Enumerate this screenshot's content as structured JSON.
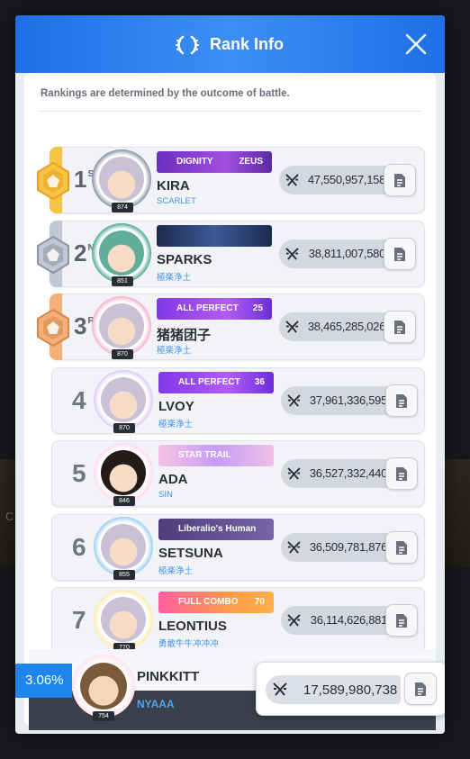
{
  "window": {
    "title": "Rank Info"
  },
  "description": "Rankings are determined by the outcome of battle.",
  "background_text": "C",
  "colors": {
    "header": "#2a82f0",
    "gold": "#f2b233",
    "silver": "#9ea6b4",
    "bronze": "#f0a05a",
    "guild": "#3d93e8",
    "percent": "#1f86e9"
  },
  "rankings": [
    {
      "rank": "1",
      "suffix": "ST",
      "medal": "gold",
      "level": "874",
      "name": "KIRA",
      "guild": "SCARLET",
      "badge": {
        "text1": "DIGNITY",
        "text2": "ZEUS",
        "style": "dignity"
      },
      "score": "47,550,957,158"
    },
    {
      "rank": "2",
      "suffix": "ND",
      "medal": "silver",
      "level": "851",
      "name": "SPARKS",
      "guild": "極楽浄土",
      "badge": {
        "text1": "",
        "text2": "",
        "style": "wings"
      },
      "score": "38,811,007,580"
    },
    {
      "rank": "3",
      "suffix": "RD",
      "medal": "bronze",
      "level": "870",
      "name": "猪猪团子",
      "guild": "極楽浄土",
      "badge": {
        "text1": "ALL PERFECT",
        "text2": "25",
        "style": "allperfect"
      },
      "score": "38,465,285,026"
    },
    {
      "rank": "4",
      "suffix": "",
      "medal": "",
      "level": "870",
      "name": "LVOY",
      "guild": "極楽浄土",
      "badge": {
        "text1": "ALL PERFECT",
        "text2": "36",
        "style": "allperfect"
      },
      "score": "37,961,336,595"
    },
    {
      "rank": "5",
      "suffix": "",
      "medal": "",
      "level": "846",
      "name": "ADA",
      "guild": "SIN",
      "badge": {
        "text1": "STAR TRAIL",
        "text2": "",
        "style": "startrail"
      },
      "score": "36,527,332,440"
    },
    {
      "rank": "6",
      "suffix": "",
      "medal": "",
      "level": "855",
      "name": "SETSUNA",
      "guild": "極楽浄土",
      "badge": {
        "text1": "Liberalio's Human",
        "text2": "",
        "style": "liberalio"
      },
      "score": "36,509,781,876"
    },
    {
      "rank": "7",
      "suffix": "",
      "medal": "",
      "level": "770",
      "name": "LEONTIUS",
      "guild": "勇敢牛牛冲冲冲",
      "badge": {
        "text1": "FULL COMBO",
        "text2": "70",
        "style": "fullcombo"
      },
      "score": "36,114,626,881"
    }
  ],
  "me": {
    "percent": "3.06%",
    "level": "754",
    "name": "PINKKITT",
    "guild": "NYAAA",
    "score": "17,589,980,738"
  }
}
